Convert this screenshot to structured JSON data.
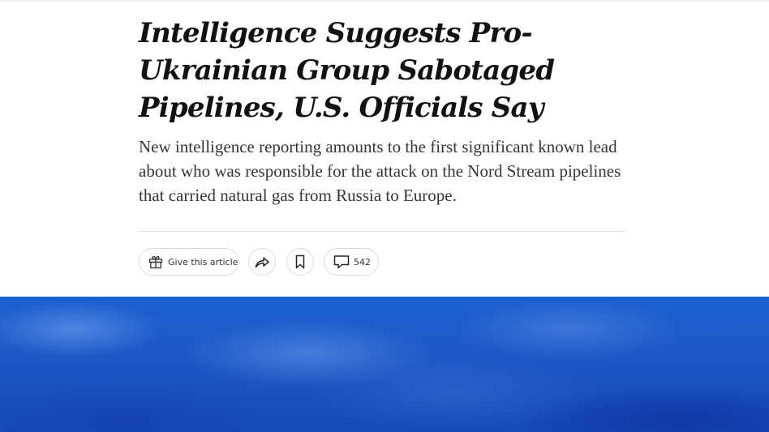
{
  "article": {
    "headline": "Intelligence Suggests Pro-Ukrainian Group Sabotaged Pipelines, U.S. Officials Say",
    "summary": "New intelligence reporting amounts to the first significant known lead about who was responsible for the attack on the Nord Stream pipelines that carried natural gas from Russia to Europe."
  },
  "toolbar": {
    "gift_label": "Give this article",
    "comment_count": "542"
  },
  "icons": {
    "gift": "gift-icon",
    "share": "share-icon",
    "save": "bookmark-icon",
    "comments": "comment-icon"
  },
  "colors": {
    "headline": "#121212",
    "summary": "#363636",
    "hero_sky": "#1c5fd0"
  }
}
